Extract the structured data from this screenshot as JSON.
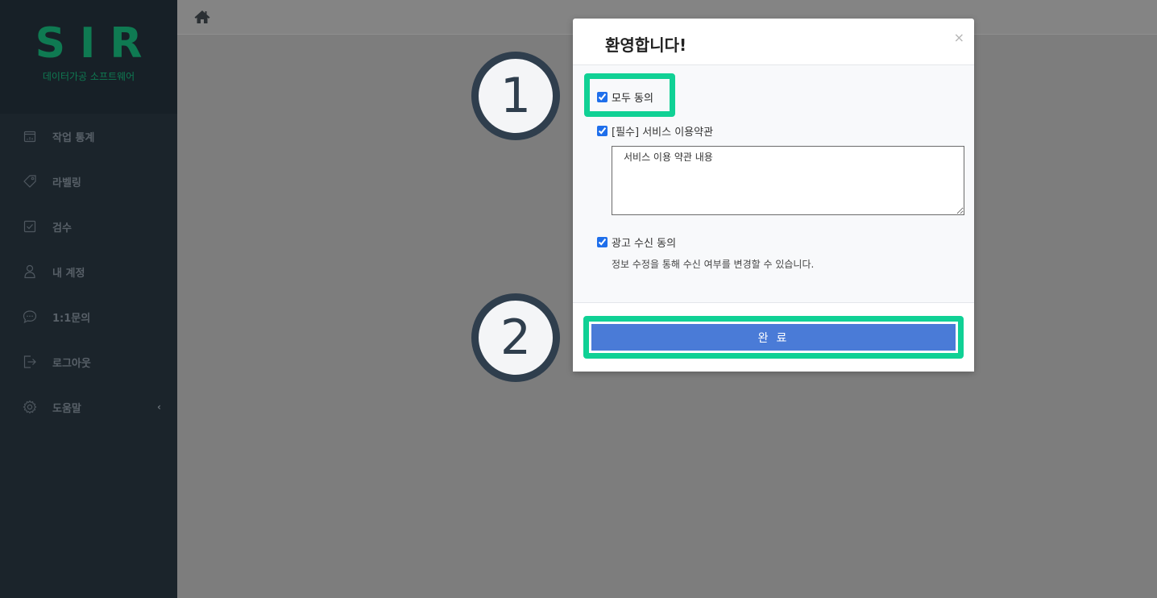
{
  "brand": {
    "logo": "SIR",
    "subtitle": "데이터가공 소프트웨어",
    "color": "#0f7a52"
  },
  "sidebar": {
    "items": [
      {
        "label": "작업 통계",
        "icon": "calendar-icon"
      },
      {
        "label": "라벨링",
        "icon": "tag-icon"
      },
      {
        "label": "검수",
        "icon": "checkbox-icon"
      },
      {
        "label": "내 계정",
        "icon": "user-icon"
      },
      {
        "label": "1:1문의",
        "icon": "chat-icon"
      },
      {
        "label": "로그아웃",
        "icon": "logout-icon"
      },
      {
        "label": "도움말",
        "icon": "gear-icon",
        "chevron": "‹"
      }
    ]
  },
  "topbar": {
    "home_icon": "home-icon"
  },
  "modal": {
    "title": "환영합니다!",
    "close": "×",
    "agree_all_label": "모두 동의",
    "required_terms_label": "[필수] 서비스 이용약관",
    "terms_content": "서비스 이용 약관 내용",
    "ad_agree_label": "광고 수신 동의",
    "ad_note": "정보 수정을 통해 수신 여부를 변경할 수 있습니다.",
    "done_label": "완 료"
  },
  "markers": {
    "step1": "1",
    "step2": "2"
  },
  "colors": {
    "highlight": "#10d195",
    "button": "#4a7bd7",
    "marker": "#2f3e4d"
  }
}
